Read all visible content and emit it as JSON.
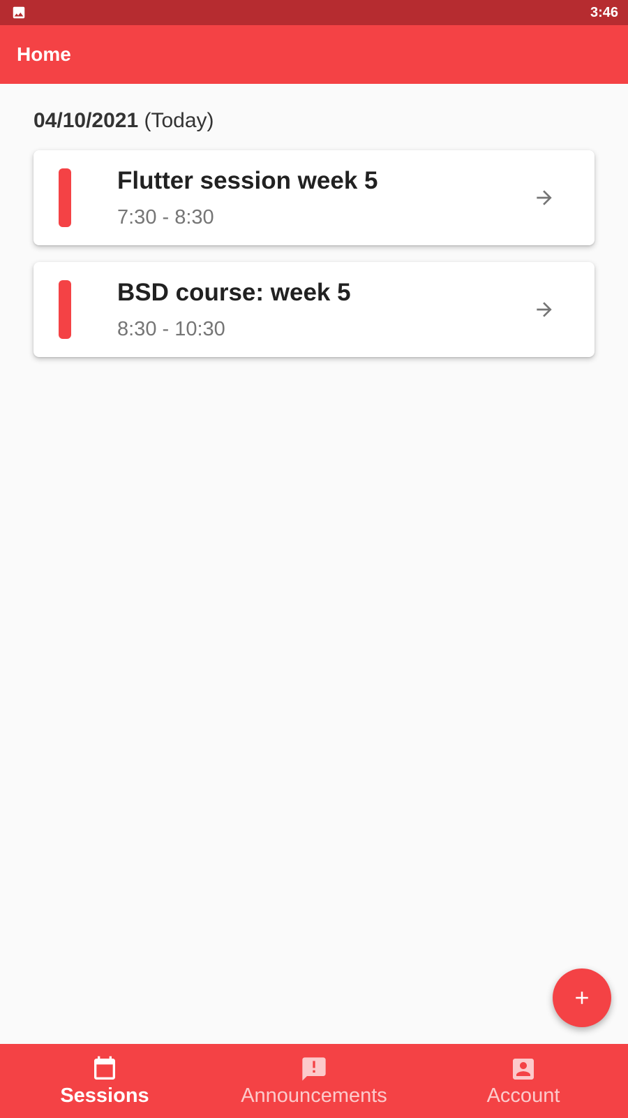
{
  "status_bar": {
    "time": "3:46",
    "left_icon": "image-icon"
  },
  "app_bar": {
    "title": "Home"
  },
  "date_header": {
    "date": "04/10/2021",
    "suffix": " (Today)"
  },
  "sessions": [
    {
      "title": "Flutter session week 5",
      "time": "7:30 - 8:30"
    },
    {
      "title": "BSD course: week 5",
      "time": "8:30 - 10:30"
    }
  ],
  "fab": {
    "icon": "plus-icon"
  },
  "bottom_nav": {
    "items": [
      {
        "label": "Sessions",
        "icon": "calendar-icon",
        "active": true
      },
      {
        "label": "Announcements",
        "icon": "announcement-icon",
        "active": false
      },
      {
        "label": "Account",
        "icon": "account-box-icon",
        "active": false
      }
    ]
  },
  "colors": {
    "primary": "#f44245",
    "status_bar": "#b62c30",
    "background": "#fafafa"
  }
}
